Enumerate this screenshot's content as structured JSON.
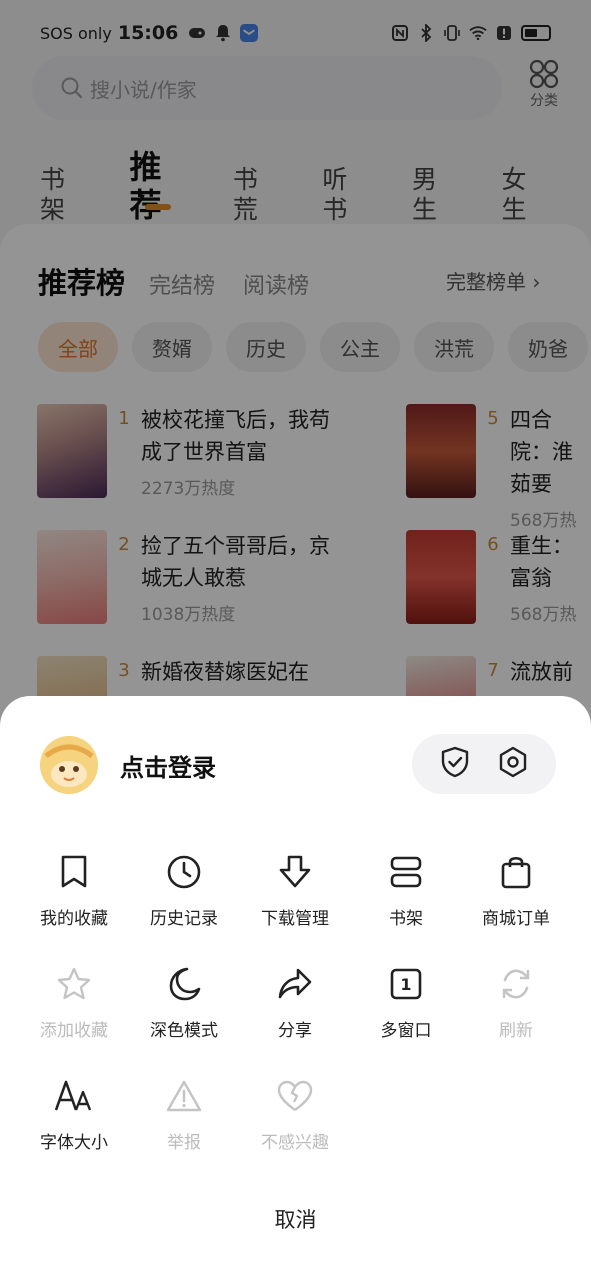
{
  "status_bar": {
    "carrier": "SOS only",
    "time": "15:06"
  },
  "search": {
    "placeholder": "搜小说/作家",
    "category_label": "分类"
  },
  "tabs": [
    "书架",
    "推荐",
    "书荒",
    "听书",
    "男生",
    "女生"
  ],
  "ranking": {
    "types": [
      "推荐榜",
      "完结榜",
      "阅读榜"
    ],
    "full_list": "完整榜单 ›",
    "chips": [
      "全部",
      "赘婿",
      "历史",
      "公主",
      "洪荒",
      "奶爸"
    ]
  },
  "books": [
    {
      "rank": "1",
      "title": "被校花撞飞后，我苟成了世界首富",
      "heat": "2273万热度"
    },
    {
      "rank": "5",
      "title": "四合院：淮茹要",
      "heat": "568万热"
    },
    {
      "rank": "2",
      "title": "捡了五个哥哥后，京城无人敢惹",
      "heat": "1038万热度"
    },
    {
      "rank": "6",
      "title": "重生：富翁",
      "heat": "568万热"
    },
    {
      "rank": "3",
      "title": "新婚夜替嫁医妃在",
      "heat": ""
    },
    {
      "rank": "7",
      "title": "流放前",
      "heat": ""
    }
  ],
  "sheet": {
    "login": "点击登录",
    "items": [
      {
        "label": "我的收藏",
        "icon": "bookmark-icon",
        "enabled": true
      },
      {
        "label": "历史记录",
        "icon": "clock-icon",
        "enabled": true
      },
      {
        "label": "下载管理",
        "icon": "download-icon",
        "enabled": true
      },
      {
        "label": "书架",
        "icon": "bookshelf-icon",
        "enabled": true
      },
      {
        "label": "商城订单",
        "icon": "shopping-bag-icon",
        "enabled": true
      },
      {
        "label": "添加收藏",
        "icon": "star-icon",
        "enabled": false
      },
      {
        "label": "深色模式",
        "icon": "moon-icon",
        "enabled": true
      },
      {
        "label": "分享",
        "icon": "share-icon",
        "enabled": true
      },
      {
        "label": "多窗口",
        "icon": "multi-window-icon",
        "enabled": true,
        "badge": "1"
      },
      {
        "label": "刷新",
        "icon": "refresh-icon",
        "enabled": false
      },
      {
        "label": "字体大小",
        "icon": "font-size-icon",
        "enabled": true
      },
      {
        "label": "举报",
        "icon": "warning-icon",
        "enabled": false
      },
      {
        "label": "不感兴趣",
        "icon": "broken-heart-icon",
        "enabled": false
      }
    ],
    "cancel": "取消"
  },
  "colors": {
    "accent": "#e08a2c",
    "overlay": "rgba(0,0,0,0.42)",
    "disabled": "#bcbcbc"
  }
}
